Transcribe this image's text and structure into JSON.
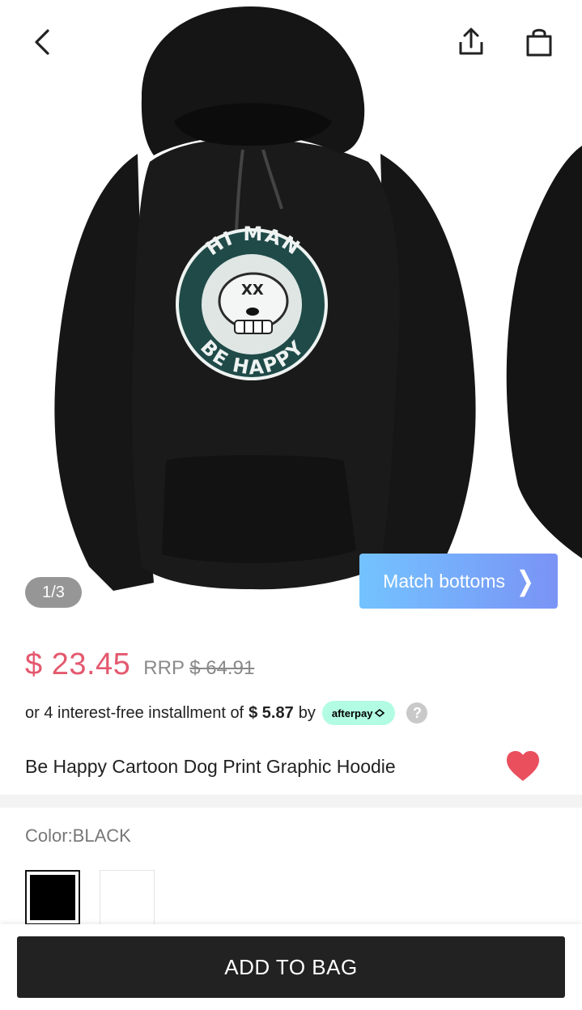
{
  "gallery": {
    "counter": "1/3",
    "artwork": {
      "top_text": "HI MAN",
      "bottom_text": "BE HAPPY"
    }
  },
  "header": {
    "back_icon": "chevron-left-icon",
    "share_icon": "share-icon",
    "bag_icon": "shopping-bag-icon"
  },
  "match_bottoms": {
    "label": "Match bottoms",
    "icon": "chevron-right-icon"
  },
  "pricing": {
    "price": "$ 23.45",
    "rrp_label": "RRP",
    "rrp_value": "$ 64.91",
    "price_color": "#e4596f"
  },
  "installment": {
    "prefix": "or 4 interest-free installment of",
    "amount": "$ 5.87",
    "suffix": "by",
    "provider": "afterpay",
    "provider_icon": "afterpay-arrows-icon",
    "help_icon": "question-icon",
    "help_glyph": "?"
  },
  "product": {
    "title": "Be Happy Cartoon Dog Print Graphic Hoodie",
    "favorite_icon": "heart-icon"
  },
  "color": {
    "label": "Color:BLACK",
    "options": [
      "black",
      "white"
    ],
    "selected": "black"
  },
  "cta": {
    "label": "ADD TO BAG"
  }
}
